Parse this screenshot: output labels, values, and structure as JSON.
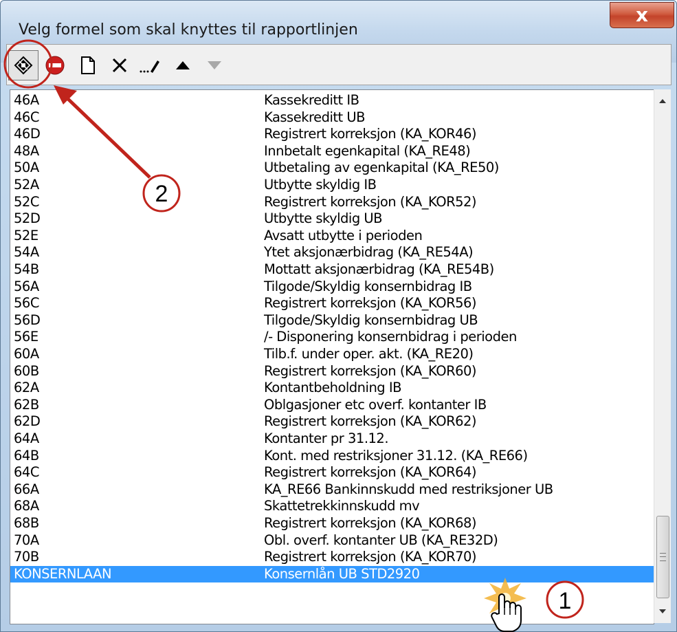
{
  "window": {
    "title": "Velg formel som skal knyttes til rapportlinjen",
    "close_label": "x"
  },
  "toolbar": {
    "buttons": [
      {
        "icon": "wizard-icon",
        "active": true
      },
      {
        "icon": "stop-icon"
      },
      {
        "icon": "new-document-icon"
      },
      {
        "icon": "delete-x-icon"
      },
      {
        "icon": "edit-pencil-icon"
      },
      {
        "icon": "move-up-arrow-icon"
      },
      {
        "icon": "move-down-arrow-icon",
        "disabled": true
      }
    ]
  },
  "list": {
    "rows": [
      {
        "code": "46A",
        "desc": "Kassekreditt IB"
      },
      {
        "code": "46C",
        "desc": "Kassekreditt UB"
      },
      {
        "code": "46D",
        "desc": "Registrert korreksjon (KA_KOR46)"
      },
      {
        "code": "48A",
        "desc": "Innbetalt egenkapital (KA_RE48)"
      },
      {
        "code": "50A",
        "desc": "Utbetaling av egenkapital (KA_RE50)"
      },
      {
        "code": "52A",
        "desc": "Utbytte skyldig IB"
      },
      {
        "code": "52C",
        "desc": "Registrert korreksjon (KA_KOR52)"
      },
      {
        "code": "52D",
        "desc": "Utbytte skyldig UB"
      },
      {
        "code": "52E",
        "desc": "Avsatt utbytte i perioden"
      },
      {
        "code": "54A",
        "desc": "Ytet aksjonærbidrag (KA_RE54A)"
      },
      {
        "code": "54B",
        "desc": "Mottatt aksjonærbidrag (KA_RE54B)"
      },
      {
        "code": "56A",
        "desc": "Tilgode/Skyldig konsernbidrag IB"
      },
      {
        "code": "56C",
        "desc": "Registrert korreksjon (KA_KOR56)"
      },
      {
        "code": "56D",
        "desc": "Tilgode/Skyldig konsernbidrag UB"
      },
      {
        "code": "56E",
        "desc": "/- Disponering konsernbidrag i perioden"
      },
      {
        "code": "60A",
        "desc": "Tilb.f. under oper. akt. (KA_RE20)"
      },
      {
        "code": "60B",
        "desc": "Registrert korreksjon (KA_KOR60)"
      },
      {
        "code": "62A",
        "desc": "Kontantbeholdning IB"
      },
      {
        "code": "62B",
        "desc": "Oblgasjoner etc overf. kontanter IB"
      },
      {
        "code": "62D",
        "desc": "Registrert korreksjon (KA_KOR62)"
      },
      {
        "code": "64A",
        "desc": "Kontanter pr 31.12."
      },
      {
        "code": "64B",
        "desc": "Kont. med restriksjoner 31.12. (KA_RE66)"
      },
      {
        "code": "64C",
        "desc": "Registrert korreksjon (KA_KOR64)"
      },
      {
        "code": "66A",
        "desc": "KA_RE66 Bankinnskudd med restriksjoner UB"
      },
      {
        "code": "68A",
        "desc": "Skattetrekkinnskudd mv"
      },
      {
        "code": "68B",
        "desc": "Registrert korreksjon (KA_KOR68)"
      },
      {
        "code": "70A",
        "desc": "Obl. overf. kontanter UB (KA_RE32D)"
      },
      {
        "code": "70B",
        "desc": "Registrert korreksjon (KA_KOR70)"
      },
      {
        "code": "KONSERNLAAN",
        "desc": "Konsernlån UB STD2920",
        "selected": true
      }
    ]
  },
  "annotations": {
    "marker_1": "1",
    "marker_2": "2",
    "annotation_color": "#c0241c"
  },
  "colors": {
    "selection": "#3399ff",
    "close_button": "#c8452c"
  }
}
